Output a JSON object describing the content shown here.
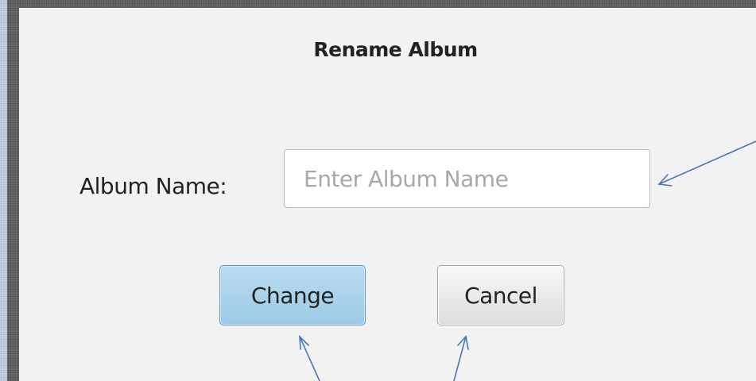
{
  "dialog": {
    "title": "Rename Album",
    "album_name_label": "Album Name:",
    "album_name_placeholder": "Enter Album Name",
    "album_name_value": "",
    "change_button_label": "Change",
    "cancel_button_label": "Cancel"
  },
  "annotations": {
    "arrow_color": "#4a77b4",
    "arrow_icon": "annotation-arrow-icon"
  },
  "colors": {
    "dialog_background": "#f2f2f2",
    "change_button": "#a8d2ec",
    "cancel_button": "#e6e6e6",
    "frame": "#6c6c6c"
  }
}
